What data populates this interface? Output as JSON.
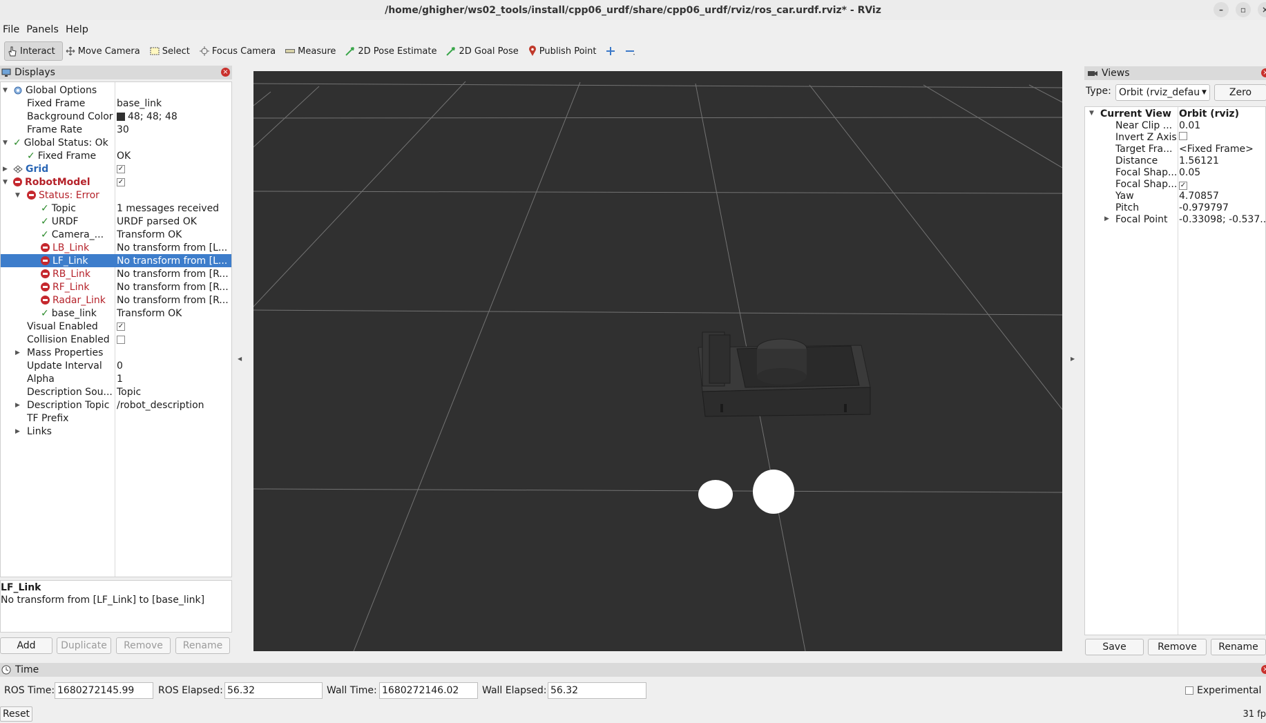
{
  "window": {
    "title": "/home/ghigher/ws02_tools/install/cpp06_urdf/share/cpp06_urdf/rviz/ros_car.urdf.rviz* - RViz"
  },
  "menu": [
    "File",
    "Panels",
    "Help"
  ],
  "toolbar": {
    "interact": "Interact",
    "move_camera": "Move Camera",
    "select": "Select",
    "focus_camera": "Focus Camera",
    "measure": "Measure",
    "pose_estimate": "2D Pose Estimate",
    "goal_pose": "2D Goal Pose",
    "publish_point": "Publish Point"
  },
  "displays": {
    "title": "Displays",
    "global_options": "Global Options",
    "fixed_frame_label": "Fixed Frame",
    "fixed_frame_value": "base_link",
    "bg_color_label": "Background Color",
    "bg_color_value": "48; 48; 48",
    "frame_rate_label": "Frame Rate",
    "frame_rate_value": "30",
    "global_status": "Global Status: Ok",
    "gs_fixed_frame_label": "Fixed Frame",
    "gs_fixed_frame_value": "OK",
    "grid": "Grid",
    "robot_model": "RobotModel",
    "status_error": "Status: Error",
    "items": [
      {
        "name": "Topic",
        "value": "1 messages received",
        "ok": true
      },
      {
        "name": "URDF",
        "value": "URDF parsed OK",
        "ok": true
      },
      {
        "name": "Camera_...",
        "value": "Transform OK",
        "ok": true
      },
      {
        "name": "LB_Link",
        "value": "No transform from [L...",
        "ok": false
      },
      {
        "name": "LF_Link",
        "value": "No transform from [L...",
        "ok": false
      },
      {
        "name": "RB_Link",
        "value": "No transform from [R...",
        "ok": false
      },
      {
        "name": "RF_Link",
        "value": "No transform from [R...",
        "ok": false
      },
      {
        "name": "Radar_Link",
        "value": "No transform from [R...",
        "ok": false
      },
      {
        "name": "base_link",
        "value": "Transform OK",
        "ok": true
      }
    ],
    "visual_enabled": "Visual Enabled",
    "collision_enabled": "Collision Enabled",
    "mass_properties": "Mass Properties",
    "update_interval_label": "Update Interval",
    "update_interval_value": "0",
    "alpha_label": "Alpha",
    "alpha_value": "1",
    "desc_source_label": "Description Sou...",
    "desc_source_value": "Topic",
    "desc_topic_label": "Description Topic",
    "desc_topic_value": "/robot_description",
    "tf_prefix": "TF Prefix",
    "links": "Links",
    "desc_title": "LF_Link",
    "desc_text": "No transform from [LF_Link] to [base_link]",
    "btn_add": "Add",
    "btn_duplicate": "Duplicate",
    "btn_remove": "Remove",
    "btn_rename": "Rename"
  },
  "views": {
    "title": "Views",
    "type_label": "Type:",
    "type_value": "Orbit (rviz_defau",
    "zero": "Zero",
    "current_view": "Current View",
    "current_view_value": "Orbit (rviz)",
    "props": [
      {
        "name": "Near Clip ...",
        "value": "0.01"
      },
      {
        "name": "Invert Z Axis",
        "value": ""
      },
      {
        "name": "Target Fra...",
        "value": "<Fixed Frame>"
      },
      {
        "name": "Distance",
        "value": "1.56121"
      },
      {
        "name": "Focal Shap...",
        "value": "0.05"
      },
      {
        "name": "Focal Shap...",
        "value": ""
      },
      {
        "name": "Yaw",
        "value": "4.70857"
      },
      {
        "name": "Pitch",
        "value": "-0.979797"
      },
      {
        "name": "Focal Point",
        "value": "-0.33098; -0.537..."
      }
    ],
    "btn_save": "Save",
    "btn_remove": "Remove",
    "btn_rename": "Rename"
  },
  "time": {
    "title": "Time",
    "ros_time_label": "ROS Time:",
    "ros_time_value": "1680272145.99",
    "ros_elapsed_label": "ROS Elapsed:",
    "ros_elapsed_value": "56.32",
    "wall_time_label": "Wall Time:",
    "wall_time_value": "1680272146.02",
    "wall_elapsed_label": "Wall Elapsed:",
    "wall_elapsed_value": "56.32",
    "experimental": "Experimental"
  },
  "status": {
    "reset": "Reset",
    "fps": "31 fp"
  },
  "colors": {
    "viewport_bg": "#303030",
    "selection": "#3d7dcb",
    "error": "#c5282e",
    "ok": "#2a8a2a"
  }
}
